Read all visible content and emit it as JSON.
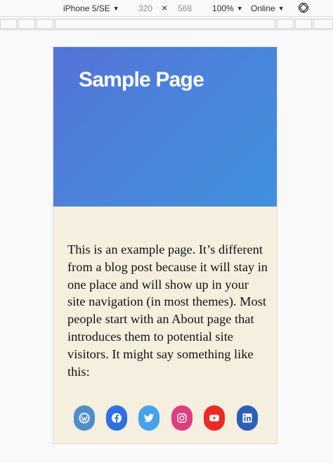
{
  "toolbar": {
    "device": "iPhone 5/SE",
    "width": "320",
    "times": "×",
    "height": "568",
    "zoom": "100%",
    "network": "Online",
    "caret": "▼"
  },
  "page": {
    "title": "Sample Page",
    "body": "This is an example page. It’s different from a blog post because it will stay in one place and will show up in your site navigation (in most themes). Most people start with an About page that introduces them to potential site visitors. It might say something like this:"
  },
  "social": [
    {
      "name": "WordPress",
      "icon": "wordpress-icon",
      "color": "#4f8fc9"
    },
    {
      "name": "Facebook",
      "icon": "facebook-icon",
      "color": "#2f6fe4"
    },
    {
      "name": "Twitter",
      "icon": "twitter-icon",
      "color": "#45a3ee"
    },
    {
      "name": "Instagram",
      "icon": "instagram-icon",
      "color": "#df3d82"
    },
    {
      "name": "YouTube",
      "icon": "youtube-icon",
      "color": "#ec2a21"
    },
    {
      "name": "LinkedIn",
      "icon": "linkedin-icon",
      "color": "#2a60b8"
    }
  ],
  "colors": {
    "hero_start": "#5473d8",
    "hero_end": "#4090de",
    "content_bg": "#f5efe0",
    "text": "#111111"
  }
}
